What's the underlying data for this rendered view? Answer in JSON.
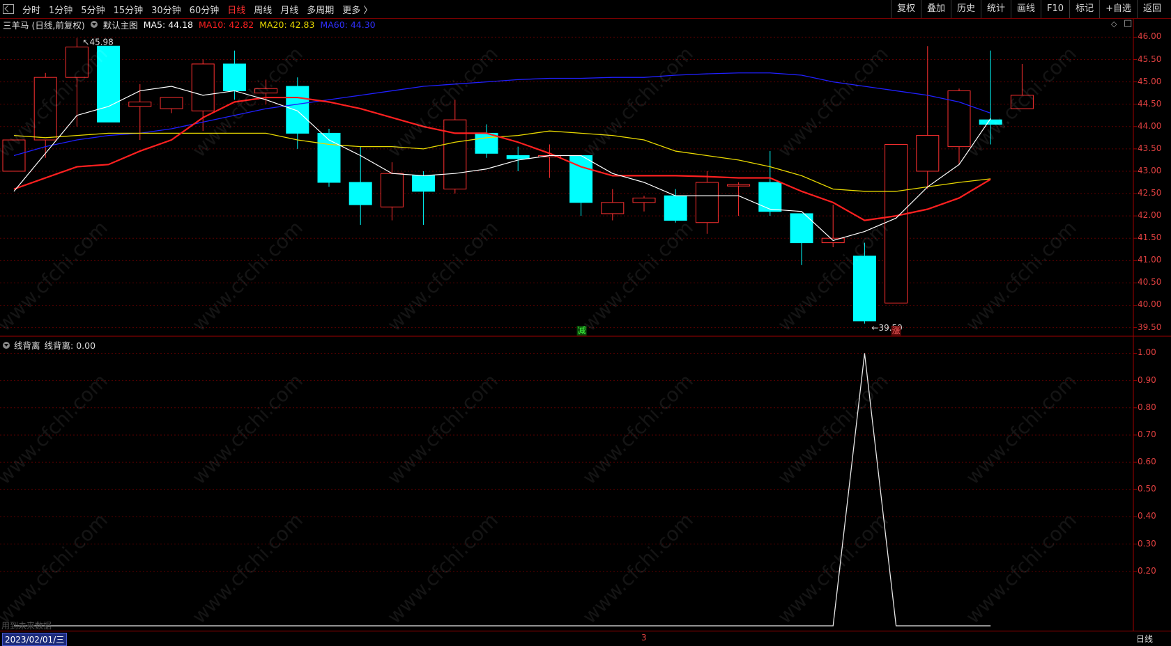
{
  "toolbar": {
    "left_items": [
      "分时",
      "1分钟",
      "5分钟",
      "15分钟",
      "30分钟",
      "60分钟",
      "日线",
      "周线",
      "月线",
      "多周期",
      "更多 〉"
    ],
    "active_item": "日线",
    "right_items": [
      "复权",
      "叠加",
      "历史",
      "统计",
      "画线",
      "F10",
      "标记",
      "+自选",
      "返回"
    ]
  },
  "legend": {
    "title": "三羊马 (日线,前复权)",
    "template": "默认主图",
    "ma5": "MA5: 44.18",
    "ma10": "MA10: 42.82",
    "ma20": "MA20: 42.83",
    "ma60": "MA60: 44.30",
    "colors": {
      "ma5": "#ffffff",
      "ma10": "#ff2020",
      "ma20": "#e8d800",
      "ma60": "#2020ff",
      "up": "#ff3030",
      "down": "#00ffff"
    }
  },
  "indicator_legend": {
    "name": "线背离",
    "value": "线背离: 0.00"
  },
  "annotations": {
    "high_label": "45.98",
    "low_label": "39.59",
    "sell_marker": "减",
    "buy_marker": "涨",
    "date": "2023/02/01/三",
    "period": "日线",
    "count_marker": "3",
    "bottom_note": "用到未来数据",
    "watermark": "www.cfchi.com"
  },
  "chart_data": [
    {
      "type": "candlestick",
      "ylim": [
        39.4,
        46.1
      ],
      "yticks": [
        "46.00",
        "45.50",
        "45.00",
        "44.50",
        "44.00",
        "43.50",
        "43.00",
        "42.50",
        "42.00",
        "41.50",
        "41.00",
        "40.50",
        "40.00",
        "39.50"
      ],
      "candles": [
        {
          "o": 43.0,
          "c": 43.7,
          "h": 43.7,
          "l": 43.0
        },
        {
          "o": 43.7,
          "c": 45.1,
          "h": 45.2,
          "l": 43.3
        },
        {
          "o": 45.1,
          "c": 45.78,
          "h": 45.98,
          "l": 44.0
        },
        {
          "o": 45.8,
          "c": 44.1,
          "h": 45.8,
          "l": 44.1
        },
        {
          "o": 44.45,
          "c": 44.55,
          "h": 44.95,
          "l": 43.7
        },
        {
          "o": 44.4,
          "c": 44.65,
          "h": 44.65,
          "l": 44.3
        },
        {
          "o": 44.35,
          "c": 45.4,
          "h": 45.5,
          "l": 43.9
        },
        {
          "o": 45.4,
          "c": 44.8,
          "h": 45.7,
          "l": 44.6
        },
        {
          "o": 44.75,
          "c": 44.85,
          "h": 45.05,
          "l": 44.5
        },
        {
          "o": 44.9,
          "c": 43.85,
          "h": 45.1,
          "l": 43.5
        },
        {
          "o": 43.85,
          "c": 42.75,
          "h": 43.95,
          "l": 42.65
        },
        {
          "o": 42.75,
          "c": 42.25,
          "h": 43.55,
          "l": 41.8
        },
        {
          "o": 42.2,
          "c": 42.95,
          "h": 43.2,
          "l": 41.9
        },
        {
          "o": 42.9,
          "c": 42.55,
          "h": 43.0,
          "l": 41.8
        },
        {
          "o": 42.6,
          "c": 44.15,
          "h": 44.6,
          "l": 42.5
        },
        {
          "o": 43.85,
          "c": 43.4,
          "h": 44.05,
          "l": 43.3
        },
        {
          "o": 43.35,
          "c": 43.28,
          "h": 43.55,
          "l": 43.0
        },
        {
          "o": 43.35,
          "c": 43.35,
          "h": 43.6,
          "l": 42.85
        },
        {
          "o": 43.35,
          "c": 42.3,
          "h": 43.35,
          "l": 42.0
        },
        {
          "o": 42.05,
          "c": 42.3,
          "h": 42.6,
          "l": 41.9
        },
        {
          "o": 42.3,
          "c": 42.4,
          "h": 42.45,
          "l": 42.1
        },
        {
          "o": 42.45,
          "c": 41.9,
          "h": 42.6,
          "l": 41.85
        },
        {
          "o": 41.85,
          "c": 42.75,
          "h": 43.0,
          "l": 41.6
        },
        {
          "o": 42.7,
          "c": 42.7,
          "h": 42.75,
          "l": 42.0
        },
        {
          "o": 42.75,
          "c": 42.1,
          "h": 43.45,
          "l": 42.0
        },
        {
          "o": 42.05,
          "c": 41.4,
          "h": 42.05,
          "l": 40.9
        },
        {
          "o": 41.4,
          "c": 41.5,
          "h": 42.25,
          "l": 41.3
        },
        {
          "o": 41.1,
          "c": 39.65,
          "h": 41.4,
          "l": 39.59
        },
        {
          "o": 40.05,
          "c": 43.6,
          "h": 43.6,
          "l": 40.05
        },
        {
          "o": 43.0,
          "c": 43.8,
          "h": 45.8,
          "l": 42.6
        },
        {
          "o": 43.55,
          "c": 44.8,
          "h": 44.85,
          "l": 43.15
        },
        {
          "o": 44.15,
          "c": 44.05,
          "h": 45.7,
          "l": 43.6
        },
        {
          "o": 44.4,
          "c": 44.7,
          "h": 45.4,
          "l": 44.4
        }
      ],
      "ma5": [
        42.55,
        43.4,
        44.25,
        44.45,
        44.8,
        44.9,
        44.7,
        44.8,
        44.6,
        44.35,
        43.7,
        43.35,
        42.95,
        42.9,
        42.95,
        43.05,
        43.25,
        43.35,
        43.35,
        42.95,
        42.75,
        42.45,
        42.45,
        42.45,
        42.15,
        42.1,
        41.45,
        41.65,
        41.95,
        42.65,
        43.15,
        44.18
      ],
      "ma10": [
        42.6,
        42.85,
        43.1,
        43.15,
        43.45,
        43.7,
        44.2,
        44.55,
        44.65,
        44.65,
        44.55,
        44.4,
        44.2,
        44.0,
        43.85,
        43.85,
        43.65,
        43.4,
        43.1,
        42.9,
        42.9,
        42.9,
        42.88,
        42.85,
        42.85,
        42.55,
        42.3,
        41.9,
        42.0,
        42.15,
        42.4,
        42.82
      ],
      "ma20": [
        43.8,
        43.75,
        43.8,
        43.85,
        43.85,
        43.85,
        43.85,
        43.85,
        43.85,
        43.7,
        43.6,
        43.55,
        43.55,
        43.5,
        43.65,
        43.75,
        43.8,
        43.9,
        43.85,
        43.8,
        43.7,
        43.45,
        43.35,
        43.25,
        43.1,
        42.9,
        42.6,
        42.55,
        42.55,
        42.65,
        42.75,
        42.83
      ],
      "ma60": [
        43.35,
        43.55,
        43.7,
        43.8,
        43.85,
        43.95,
        44.1,
        44.25,
        44.4,
        44.5,
        44.6,
        44.7,
        44.8,
        44.9,
        44.95,
        45.0,
        45.05,
        45.08,
        45.08,
        45.1,
        45.1,
        45.15,
        45.18,
        45.2,
        45.2,
        45.15,
        45.0,
        44.9,
        44.8,
        44.7,
        44.55,
        44.3
      ]
    },
    {
      "type": "line",
      "name": "线背离",
      "ylim": [
        0.0,
        1.06
      ],
      "yticks": [
        "1.00",
        "0.90",
        "0.80",
        "0.70",
        "0.60",
        "0.50",
        "0.40",
        "0.30",
        "0.20"
      ],
      "values": [
        0,
        0,
        0,
        0,
        0,
        0,
        0,
        0,
        0,
        0,
        0,
        0,
        0,
        0,
        0,
        0,
        0,
        0,
        0,
        0,
        0,
        0,
        0,
        0,
        0,
        0,
        0,
        1,
        0,
        0,
        0,
        0
      ]
    }
  ]
}
